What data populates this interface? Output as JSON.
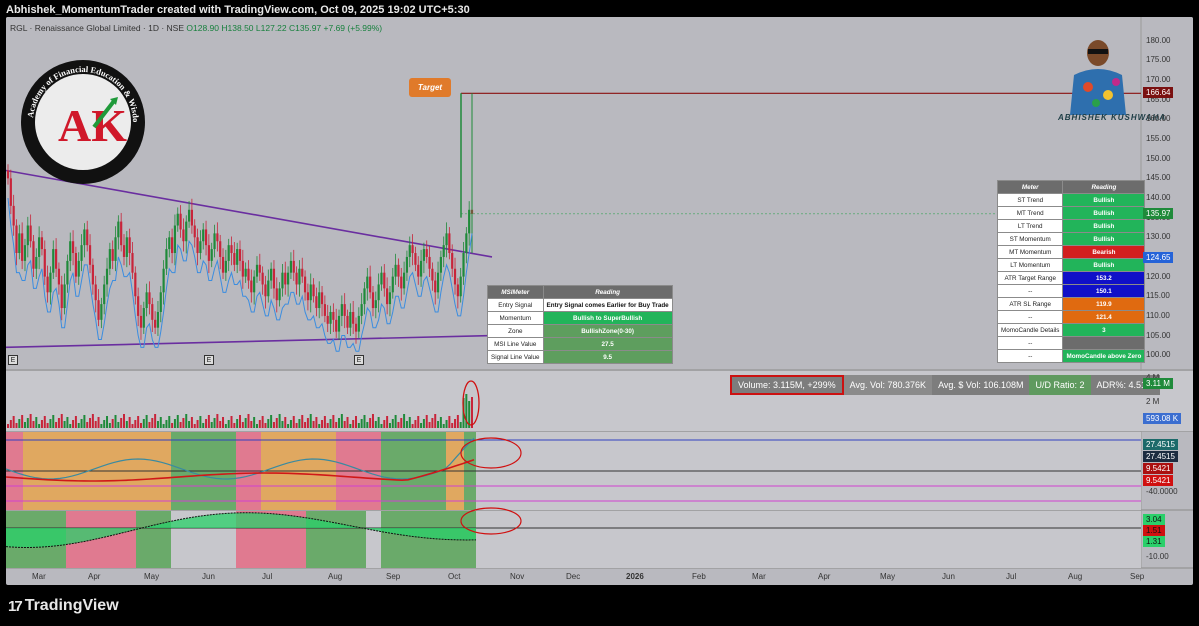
{
  "header": {
    "title": "Abhishek_MomentumTrader created with TradingView.com, Oct 09, 2025 19:02 UTC+5:30"
  },
  "symbol_line": {
    "name": "RGL · Renaissance Global Limited · 1D · NSE",
    "open": "O128.90",
    "high": "H138.50",
    "low": "L127.22",
    "close": "C135.97",
    "change": "+7.69 (+5.99%)"
  },
  "logo": {
    "text": "Academy of Financial Education & Wisdom",
    "mark": "AK"
  },
  "avatar": {
    "name": "ABHISHEK KUSHWAHA"
  },
  "target_label": "Target",
  "footer": {
    "brand": "TradingView",
    "mark": "17"
  },
  "meter_main": {
    "headers": [
      "Meter",
      "Reading"
    ],
    "rows": [
      {
        "k": "ST Trend",
        "v": "Bullish",
        "color": "#22b45a"
      },
      {
        "k": "MT Trend",
        "v": "Bullish",
        "color": "#22b45a"
      },
      {
        "k": "LT Trend",
        "v": "Bullish",
        "color": "#22b45a"
      },
      {
        "k": "ST Momentum",
        "v": "Bullish",
        "color": "#22b45a"
      },
      {
        "k": "MT Momentum",
        "v": "Bearish",
        "color": "#d21f1f"
      },
      {
        "k": "LT Momentum",
        "v": "Bullish",
        "color": "#22b45a"
      },
      {
        "k": "ATR Target Range",
        "v": "153.2",
        "color": "#1010c8"
      },
      {
        "k": "--",
        "v": "150.1",
        "color": "#1010c8"
      },
      {
        "k": "ATR SL Range",
        "v": "119.9",
        "color": "#e06a10"
      },
      {
        "k": "--",
        "v": "121.4",
        "color": "#e06a10"
      },
      {
        "k": "MomoCandle Details",
        "v": "3",
        "color": "#22b45a"
      },
      {
        "k": "--",
        "v": "",
        "color": "#6c6c6c"
      },
      {
        "k": "--",
        "v": "MomoCandle above Zero",
        "color": "#22b45a"
      }
    ]
  },
  "meter_msi": {
    "headers": [
      "MSIMeter",
      "Reading"
    ],
    "rows": [
      {
        "k": "Entry Signal",
        "v": "Entry Signal comes Earlier for Buy Trade",
        "color": "#ffffff",
        "text": "#111"
      },
      {
        "k": "Momentum",
        "v": "Bullish to SuperBullish",
        "color": "#22b45a",
        "text": "#fff"
      },
      {
        "k": "Zone",
        "v": "BullishZone(0-30)",
        "color": "#5e9e5e",
        "text": "#fff"
      },
      {
        "k": "MSI Line Value",
        "v": "27.5",
        "color": "#5e9e5e",
        "text": "#fff"
      },
      {
        "k": "Signal Line Value",
        "v": "9.5",
        "color": "#5e9e5e",
        "text": "#fff"
      }
    ]
  },
  "volume_bar": {
    "volume": "Volume: 3.115M, +299%",
    "avg_vol": "Avg. Vol: 780.376K",
    "avg_dollar_vol": "Avg. $ Vol: 106.108M",
    "ud_ratio": "U/D Ratio: 2",
    "adr": "ADR%: 4.51%"
  },
  "colors": {
    "chart_bg": "#b9b9bf",
    "up": "#1f8a3a",
    "down": "#c8243a",
    "trendline": "#6a2ea0",
    "target_line": "#8a1111",
    "blue_line": "#3b8de0",
    "zone_red": "#e07a90",
    "zone_orange": "#e0a860",
    "zone_green": "#6aaa6a",
    "badge_target": "#7a1010",
    "badge_close": "#1f8a3a",
    "badge_blue": "#2563d8"
  },
  "chart_data": [
    {
      "type": "candlestick",
      "title": "RGL · Renaissance Global Limited · 1D · NSE",
      "y_axis": {
        "ticks": [
          100,
          105,
          110,
          115,
          120,
          125,
          130,
          135,
          140,
          145,
          150,
          155,
          160,
          165,
          170,
          175,
          180
        ],
        "labels": [
          "100.00",
          "105.00",
          "110.00",
          "115.00",
          "120.00",
          "125.00",
          "130.00",
          "135.00",
          "140.00",
          "145.00",
          "150.00",
          "155.00",
          "160.00",
          "165.00",
          "170.00",
          "175.00",
          "180.00"
        ],
        "ylim": [
          97,
          183
        ]
      },
      "x_axis": {
        "labels": [
          "Mar",
          "Apr",
          "May",
          "Jun",
          "Jul",
          "Aug",
          "Sep",
          "Oct",
          "Nov",
          "Dec",
          "2026",
          "Feb",
          "Mar",
          "Apr",
          "May",
          "Jun",
          "Jul",
          "Aug",
          "Sep"
        ]
      },
      "price_badges": [
        {
          "label": "166.64",
          "value": 166.64,
          "role": "target"
        },
        {
          "label": "135.97",
          "value": 135.97,
          "role": "close"
        },
        {
          "label": "124.65",
          "value": 124.65,
          "role": "blue"
        }
      ],
      "candles_close": [
        145,
        138,
        133,
        126,
        131,
        124,
        128,
        133,
        129,
        122,
        125,
        130,
        127,
        120,
        116,
        121,
        127,
        122,
        118,
        112,
        118,
        124,
        129,
        126,
        120,
        124,
        128,
        132,
        128,
        123,
        118,
        114,
        109,
        113,
        118,
        122,
        127,
        124,
        130,
        134,
        128,
        125,
        130,
        126,
        121,
        115,
        110,
        107,
        112,
        116,
        113,
        109,
        107,
        111,
        116,
        122,
        127,
        130,
        126,
        133,
        136,
        132,
        129,
        134,
        137,
        133,
        130,
        126,
        129,
        132,
        128,
        124,
        127,
        131,
        129,
        125,
        121,
        124,
        128,
        126,
        123,
        127,
        124,
        120,
        122,
        119,
        116,
        120,
        123,
        121,
        118,
        115,
        119,
        122,
        117,
        114,
        117,
        121,
        118,
        121,
        124,
        121,
        118,
        122,
        120,
        116,
        114,
        118,
        115,
        112,
        116,
        113,
        110,
        108,
        111,
        109,
        106,
        110,
        113,
        110,
        107,
        111,
        108,
        106,
        110,
        113,
        117,
        120,
        116,
        112,
        114,
        118,
        121,
        117,
        113,
        116,
        120,
        123,
        120,
        117,
        121,
        125,
        128,
        126,
        123,
        120,
        124,
        127,
        125,
        122,
        119,
        116,
        121,
        125,
        128,
        131,
        126,
        122,
        118,
        115,
        120,
        126,
        131,
        137,
        135.97
      ]
    },
    {
      "type": "bar",
      "title": "",
      "y_axis": {
        "labels": [
          "4 M",
          "2 M"
        ]
      },
      "badges": [
        "3.11 M",
        "593.08 K"
      ]
    },
    {
      "type": "line",
      "title": "",
      "badges": [
        "27.4515",
        "27.4515",
        "9.5421",
        "9.5421"
      ],
      "y_axis": {
        "labels": [
          "-40.0000"
        ]
      }
    },
    {
      "type": "area",
      "title": "",
      "badges": [
        "3.04",
        "1.51",
        "1.31"
      ],
      "y_axis": {
        "labels": [
          "-10.00"
        ]
      }
    }
  ]
}
